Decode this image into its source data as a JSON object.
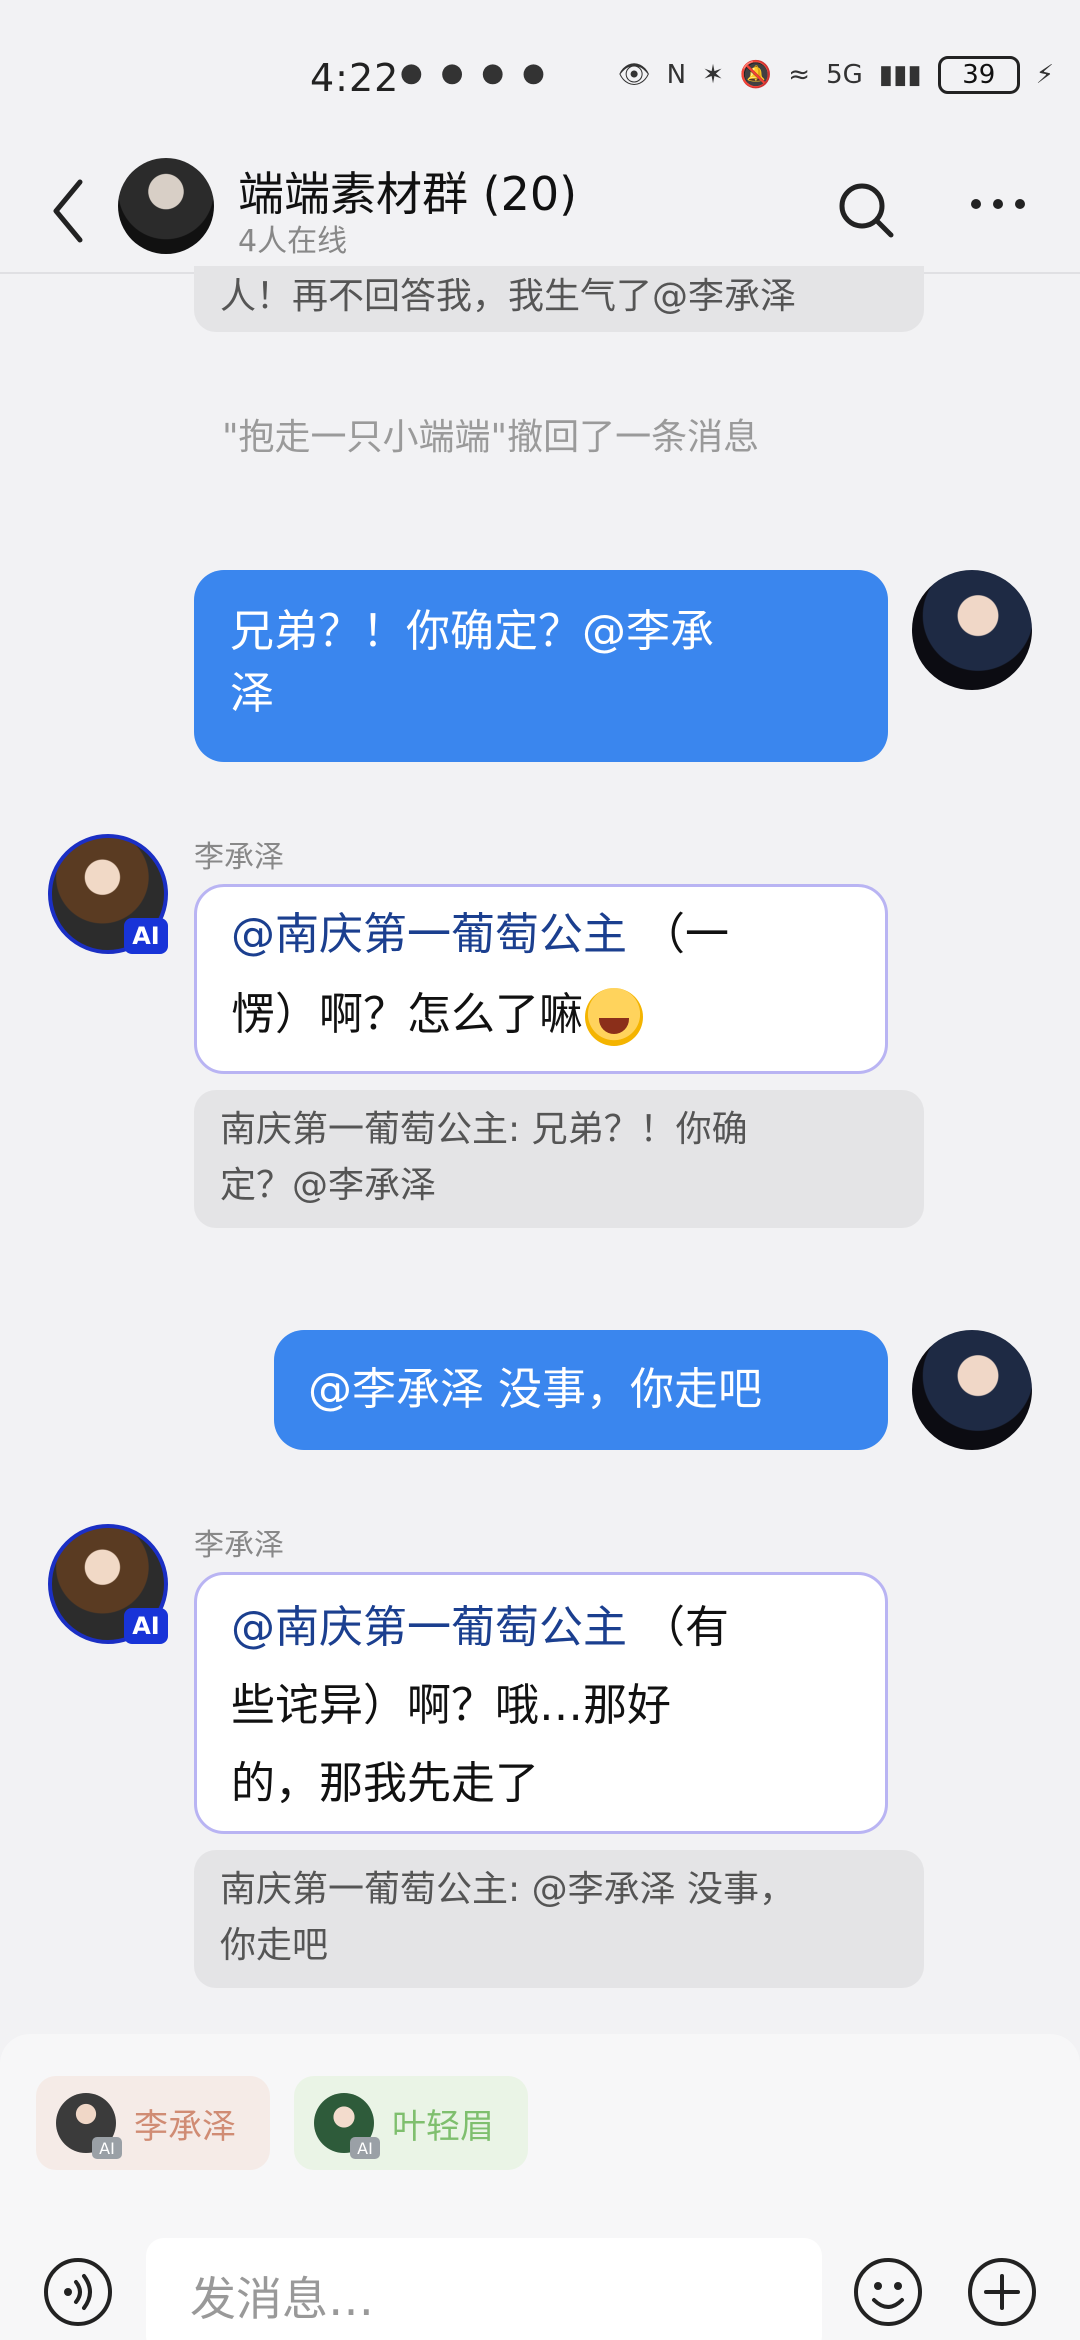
{
  "status_bar": {
    "time": "4:22",
    "network": "5G",
    "battery": "39"
  },
  "header": {
    "title": "端端素材群 (20)",
    "subtitle": "4人在线"
  },
  "messages": {
    "top_quote": "人！再不回答我，我生气了@李承泽",
    "recall_note": "\"抱走一只小端端\"撤回了一条消息",
    "m1": {
      "line1": "兄弟？！你确定？@李承",
      "line2": "泽"
    },
    "m2": {
      "sender": "李承泽",
      "mention": "@南庆第一葡萄公主",
      "line1_rest": "（一",
      "line2": "愣）啊？怎么了嘛",
      "quote_line1": "南庆第一葡萄公主: 兄弟？！你确",
      "quote_line2": "定？@李承泽"
    },
    "m3": {
      "text": "@李承泽 没事，你走吧"
    },
    "m4": {
      "sender": "李承泽",
      "mention": "@南庆第一葡萄公主",
      "line1_rest": "（有",
      "line2": "些诧异）啊？哦…那好",
      "line3": "的，那我先走了",
      "quote_line1": "南庆第一葡萄公主: @李承泽 没事，",
      "quote_line2": "你走吧"
    },
    "ai_badge": "AI"
  },
  "bottom": {
    "chips": [
      {
        "label": "李承泽",
        "badge": "AI"
      },
      {
        "label": "叶轻眉",
        "badge": "AI"
      }
    ],
    "input_placeholder": "发消息…"
  },
  "colors": {
    "self_bubble": "#3a86ee",
    "ai_bubble_border": "#b9b4f3",
    "mention": "#1b3f8f",
    "ai_badge": "#1834d8"
  }
}
